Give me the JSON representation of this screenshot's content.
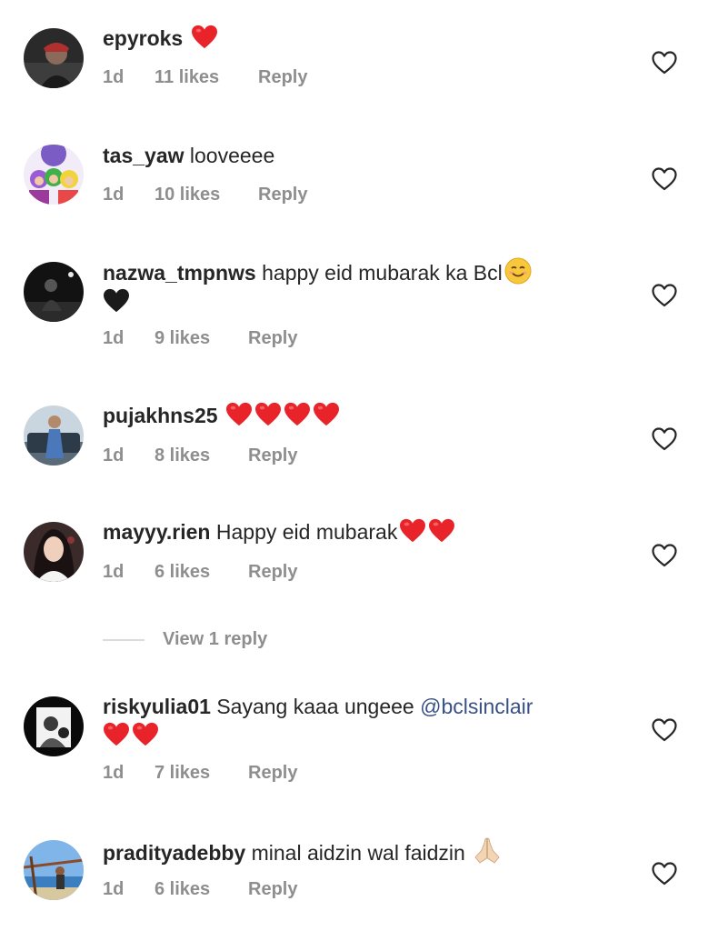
{
  "icons": {
    "like": "heart-outline-icon",
    "red_heart": "red-heart-emoji",
    "black_heart": "black-heart-emoji",
    "smiling": "smiling-face-emoji",
    "folded_hands": "folded-hands-emoji"
  },
  "colors": {
    "text": "#262626",
    "meta": "#8e8e8e",
    "mention": "#385185",
    "heart": "#ed1c24"
  },
  "comments": [
    {
      "username": "epyroks",
      "text": "",
      "time": "1d",
      "likes": "11 likes",
      "reply": "Reply"
    },
    {
      "username": "tas_yaw",
      "text": "looveeee",
      "time": "1d",
      "likes": "10 likes",
      "reply": "Reply"
    },
    {
      "username": "nazwa_tmpnws",
      "text": "happy eid mubarak ka Bcl",
      "time": "1d",
      "likes": "9 likes",
      "reply": "Reply"
    },
    {
      "username": "pujakhns25",
      "text": "",
      "time": "1d",
      "likes": "8 likes",
      "reply": "Reply"
    },
    {
      "username": "mayyy.rien",
      "text": "Happy eid mubarak",
      "time": "1d",
      "likes": "6 likes",
      "reply": "Reply"
    },
    {
      "username": "riskyulia01",
      "text": "Sayang kaaa ungeee",
      "mention": "@bclsinclair",
      "time": "1d",
      "likes": "7 likes",
      "reply": "Reply"
    },
    {
      "username": "pradityadebby",
      "text": "minal aidzin wal faidzin",
      "time": "1d",
      "likes": "6 likes",
      "reply": "Reply"
    }
  ],
  "view_replies_label": "View 1 reply"
}
